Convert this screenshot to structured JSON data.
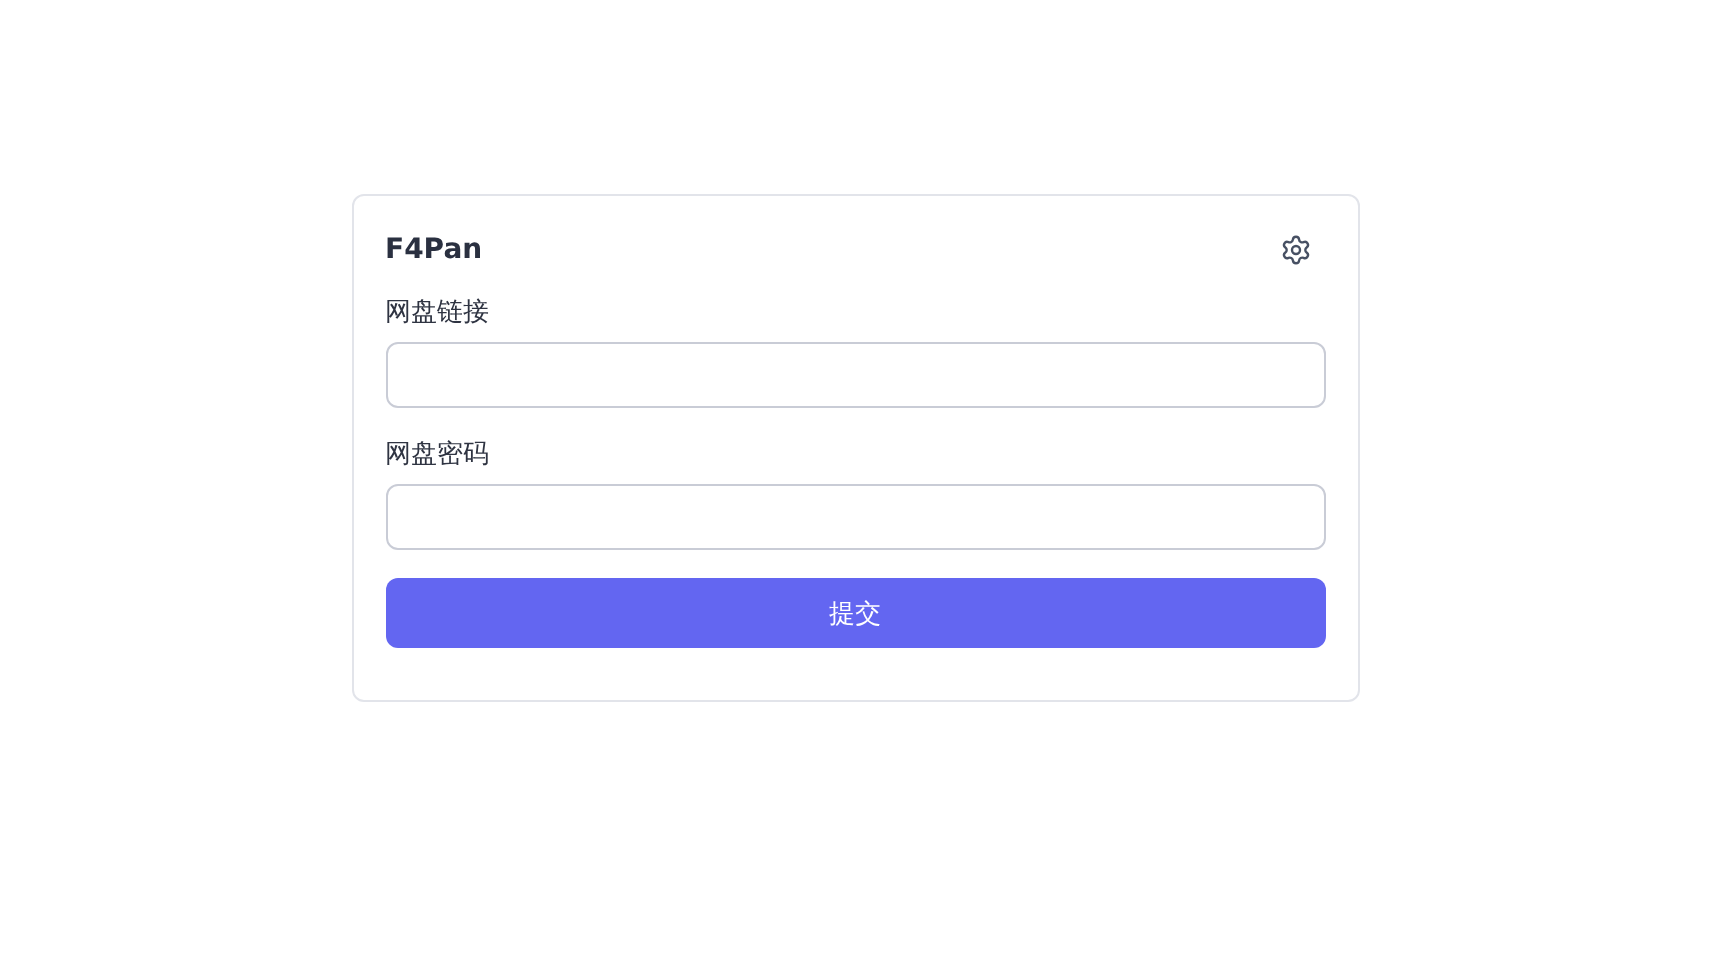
{
  "card": {
    "title": "F4Pan"
  },
  "fields": [
    {
      "label": "网盘链接"
    },
    {
      "label": "网盘密码"
    }
  ],
  "submit_button": {
    "label": "提交"
  }
}
